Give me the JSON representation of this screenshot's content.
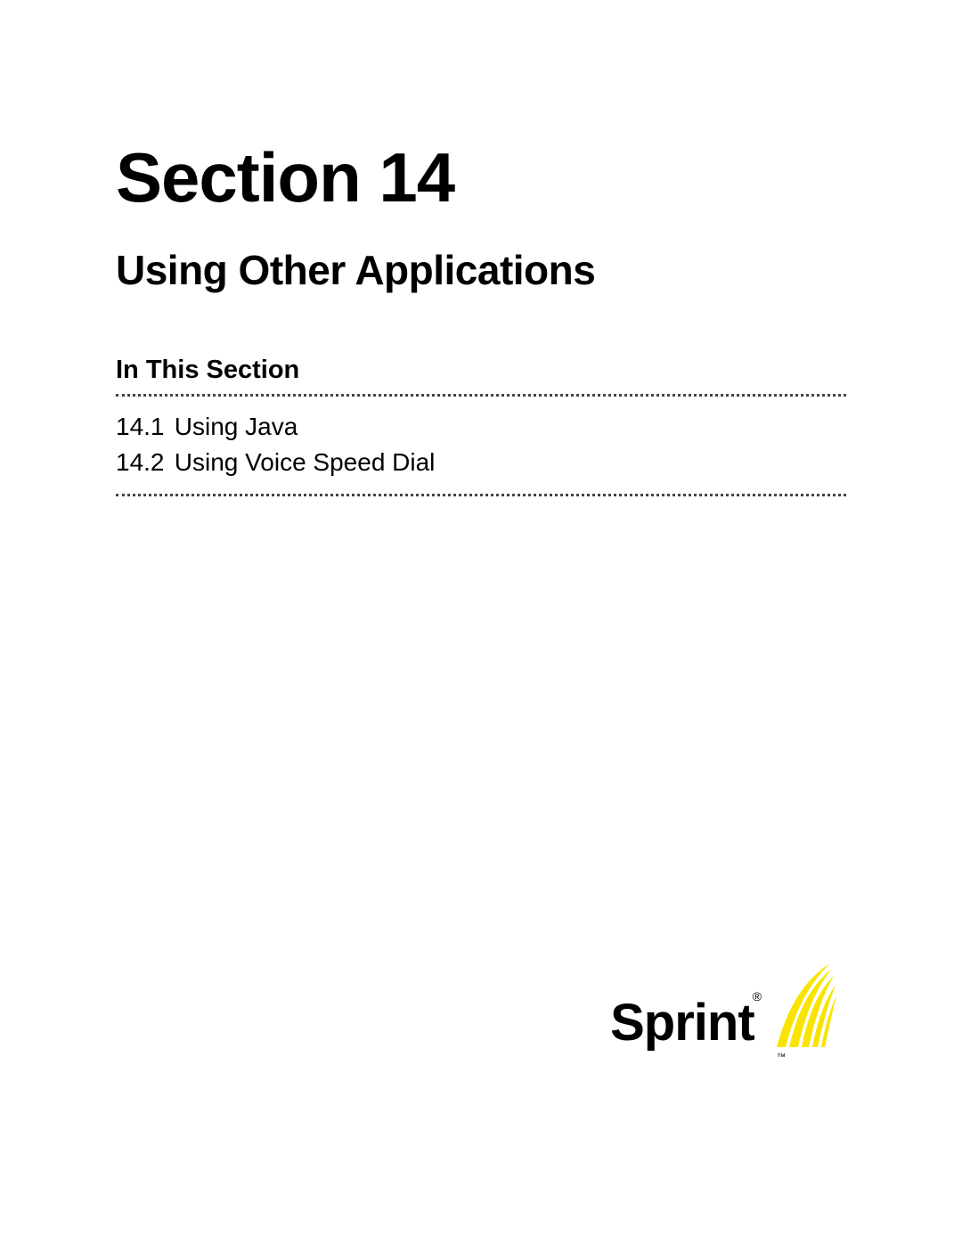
{
  "section": {
    "label": "Section 14",
    "title": "Using Other Applications",
    "in_this_section_heading": "In This Section",
    "toc": [
      {
        "num": "14.1",
        "title": "Using Java"
      },
      {
        "num": "14.2",
        "title": "Using Voice Speed Dial"
      }
    ]
  },
  "brand": {
    "name": "Sprint",
    "registered": "®",
    "trademark": "™",
    "accent_color": "#f9e400"
  }
}
